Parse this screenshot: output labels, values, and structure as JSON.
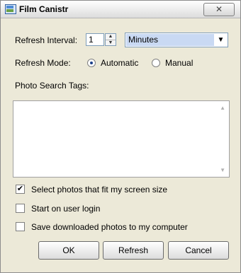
{
  "window": {
    "title": "Film Canistr",
    "close_glyph": "✕"
  },
  "refresh_interval": {
    "label": "Refresh Interval:",
    "value": "1",
    "up_glyph": "▲",
    "down_glyph": "▼",
    "unit_selected": "Minutes",
    "dropdown_glyph": "▼"
  },
  "refresh_mode": {
    "label": "Refresh Mode:",
    "options": [
      {
        "label": "Automatic",
        "selected": true
      },
      {
        "label": "Manual",
        "selected": false
      }
    ]
  },
  "photo_search_tags": {
    "label": "Photo Search Tags:",
    "value": "",
    "scroll_up_glyph": "▲",
    "scroll_down_glyph": "▼"
  },
  "options": [
    {
      "label": "Select photos that fit my screen size",
      "checked": true
    },
    {
      "label": "Start on user login",
      "checked": false
    },
    {
      "label": "Save downloaded photos to my computer",
      "checked": false
    }
  ],
  "check_glyph": "✔",
  "buttons": {
    "ok": "OK",
    "refresh": "Refresh",
    "cancel": "Cancel"
  }
}
